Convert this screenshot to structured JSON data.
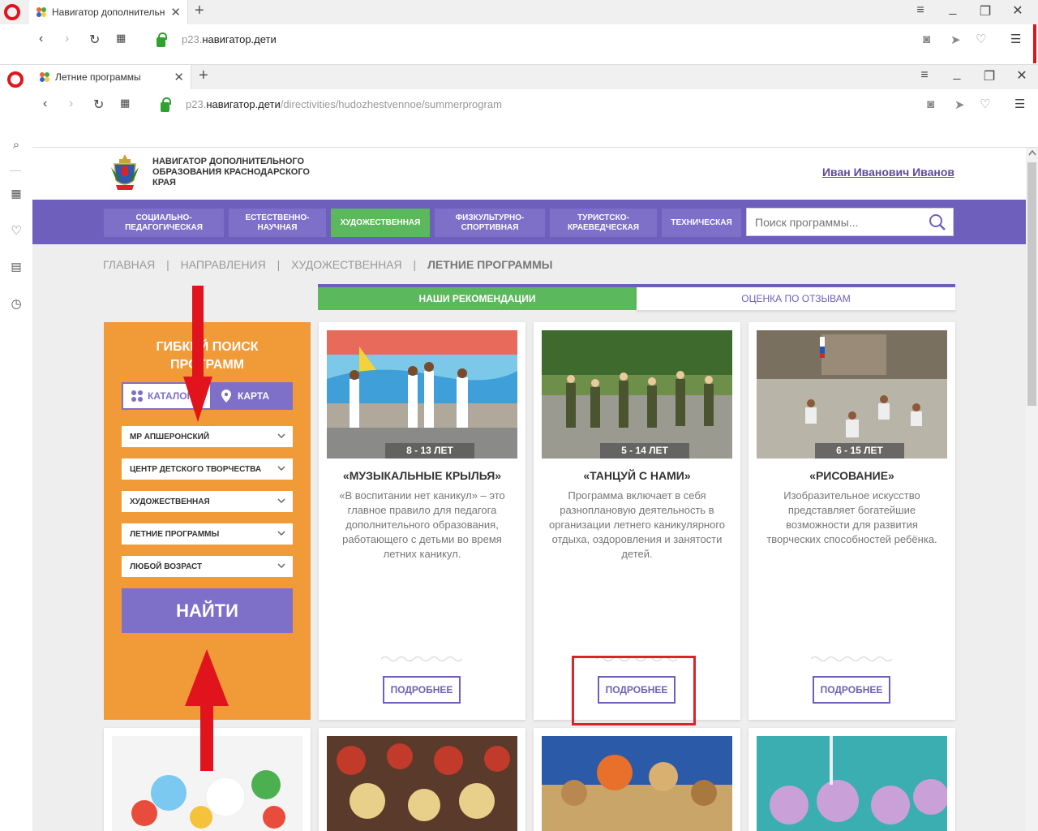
{
  "outer_browser": {
    "tab_title": "Навигатор дополнительно",
    "url_dim": "p23.",
    "url_main": "навигатор.дети",
    "url_rest": ""
  },
  "inner_browser": {
    "tab_title": "Летние программы",
    "url_dim": "p23.",
    "url_main": "навигатор.дети",
    "url_rest": "/directivities/hudozhestvennoe/summerprogram"
  },
  "site": {
    "title": "НАВИГАТОР ДОПОЛНИТЕЛЬНОГО ОБРАЗОВАНИЯ КРАСНОДАРСКОГО КРАЯ",
    "user": "Иван Иванович Иванов"
  },
  "menu": [
    {
      "label": "СОЦИАЛЬНО-ПЕДАГОГИЧЕСКАЯ",
      "active": false
    },
    {
      "label": "ЕСТЕСТВЕННО-НАУЧНАЯ",
      "active": false
    },
    {
      "label": "ХУДОЖЕСТВЕННАЯ",
      "active": true
    },
    {
      "label": "ФИЗКУЛЬТУРНО-СПОРТИВНАЯ",
      "active": false
    },
    {
      "label": "ТУРИСТСКО-КРАЕВЕДЧЕСКАЯ",
      "active": false
    },
    {
      "label": "ТЕХНИЧЕСКАЯ",
      "active": false
    }
  ],
  "search": {
    "placeholder": "Поиск программы..."
  },
  "breadcrumb": [
    "ГЛАВНАЯ",
    "|",
    "НАПРАВЛЕНИЯ",
    "|",
    "ХУДОЖЕСТВЕННАЯ",
    "|",
    "ЛЕТНИЕ ПРОГРАММЫ"
  ],
  "tabs": {
    "recommendations": "НАШИ РЕКОМЕНДАЦИИ",
    "reviews": "ОЦЕНКА ПО ОТЗЫВАМ"
  },
  "filter": {
    "title": "ГИБКИЙ ПОИСК ПРОГРАММ",
    "catalog": "КАТАЛОГ",
    "map": "КАРТА",
    "selects": [
      "МР АПШЕРОНСКИЙ",
      "ЦЕНТР ДЕТСКОГО ТВОРЧЕСТВА",
      "ХУДОЖЕСТВЕННАЯ",
      "ЛЕТНИЕ ПРОГРАММЫ",
      "ЛЮБОЙ ВОЗРАСТ"
    ],
    "find": "НАЙТИ"
  },
  "cards": [
    {
      "age": "8 - 13 ЛЕТ",
      "title": "«МУЗЫКАЛЬНЫЕ КРЫЛЬЯ»",
      "desc": "«В воспитании нет каникул» – это главное правило для педагога дополнительного образования, работающего с детьми во время летних каникул.",
      "more": "ПОДРОБНЕЕ"
    },
    {
      "age": "5 - 14 ЛЕТ",
      "title": "«ТАНЦУЙ С НАМИ»",
      "desc": "Программа включает в себя разноплановую деятельность в организации летнего каникулярного отдыха, оздоровления и занятости детей.",
      "more": "ПОДРОБНЕЕ"
    },
    {
      "age": "6 - 15 ЛЕТ",
      "title": "«РИСОВАНИЕ»",
      "desc": "Изобразительное искусство представляет богатейшие возможности для развития творческих способностей ребёнка.",
      "more": "ПОДРОБНЕЕ"
    }
  ],
  "colors": {
    "purple": "#6f5fbc",
    "green": "#5cb85c",
    "orange": "#f19a38",
    "red": "#d9232d"
  }
}
